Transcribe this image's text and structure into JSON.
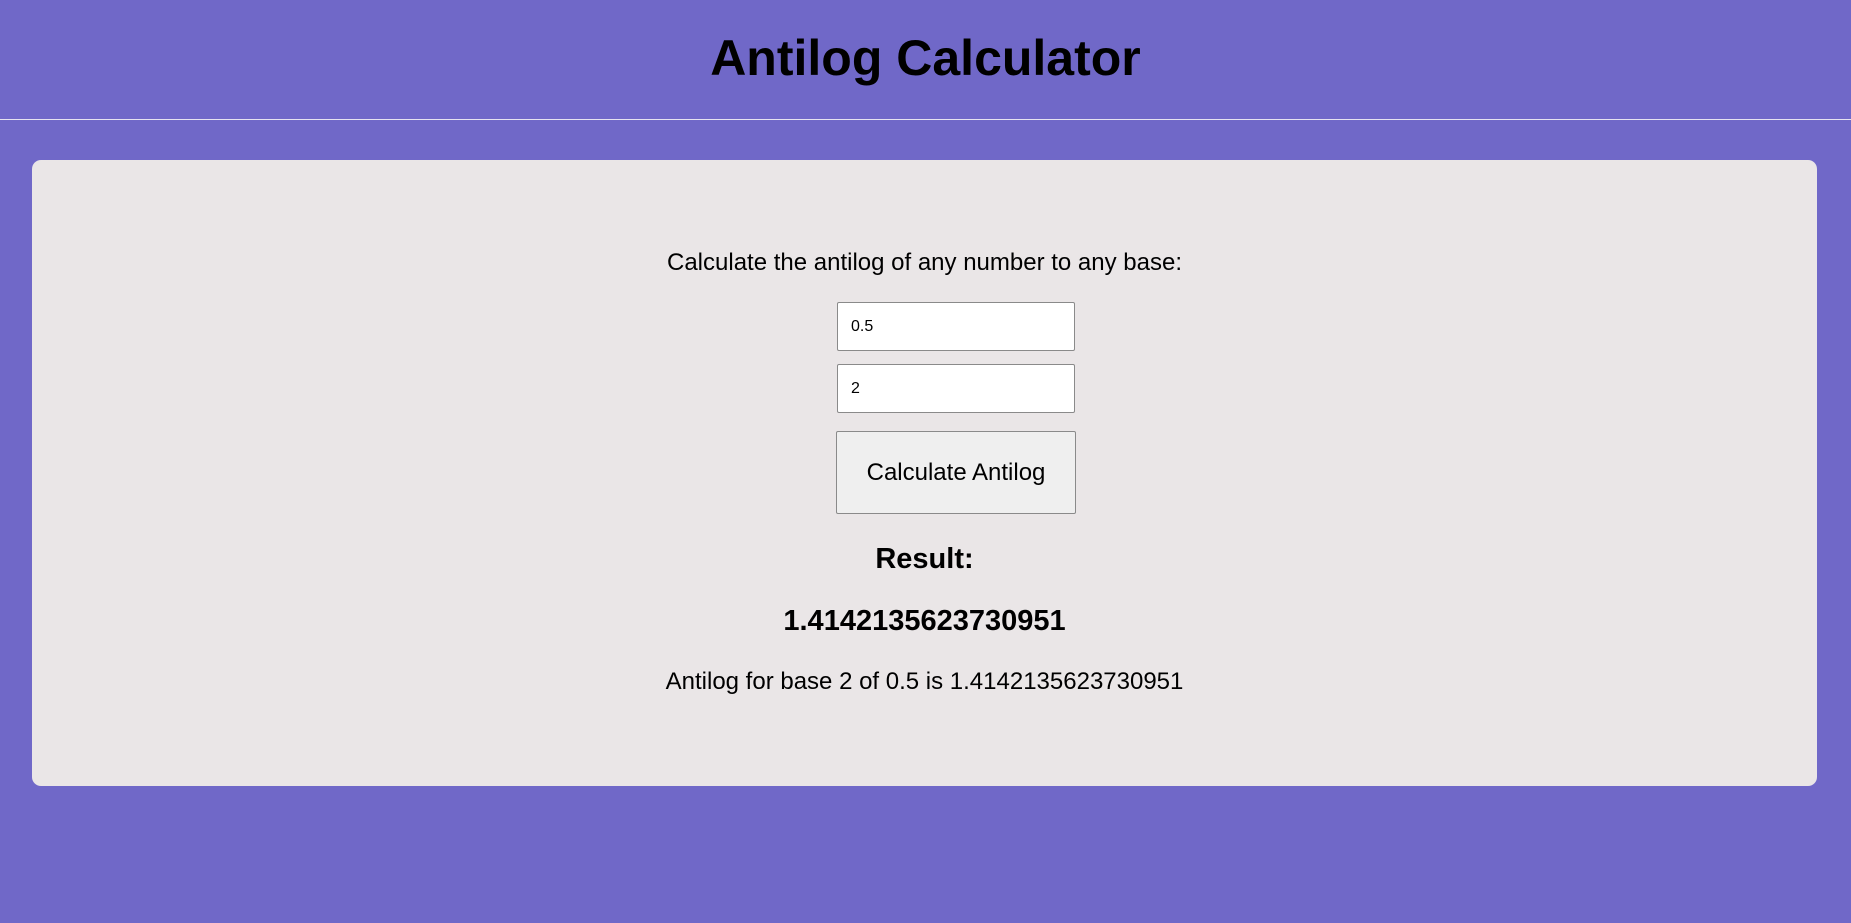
{
  "header": {
    "title": "Antilog Calculator"
  },
  "calculator": {
    "prompt": "Calculate the antilog of any number to any base:",
    "number_input": {
      "value": "0.5"
    },
    "base_input": {
      "value": "2"
    },
    "calculate_label": "Calculate Antilog",
    "result_heading": "Result:",
    "result_value": "1.4142135623730951",
    "result_sentence": "Antilog for base 2 of 0.5 is 1.4142135623730951"
  },
  "colors": {
    "page_background": "#7068c8",
    "card_background": "#eae6e7",
    "button_background": "#efefef"
  }
}
